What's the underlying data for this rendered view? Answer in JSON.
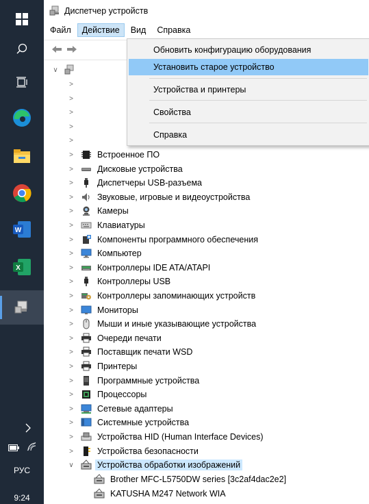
{
  "window": {
    "title": "Диспетчер устройств"
  },
  "menubar": {
    "file": "Файл",
    "action": "Действие",
    "view": "Вид",
    "help": "Справка"
  },
  "action_menu": {
    "items": [
      "Обновить конфигурацию оборудования",
      "Установить старое устройство",
      "Устройства и принтеры",
      "Свойства",
      "Справка"
    ],
    "highlighted": "Установить старое устройство"
  },
  "tree": {
    "categories": [
      {
        "label": "Встроенное ПО",
        "icon": "firmware-icon"
      },
      {
        "label": "Дисковые устройства",
        "icon": "disk-drive-icon"
      },
      {
        "label": "Диспетчеры USB-разъема",
        "icon": "usb-icon"
      },
      {
        "label": "Звуковые, игровые и видеоустройства",
        "icon": "speaker-icon"
      },
      {
        "label": "Камеры",
        "icon": "camera-icon"
      },
      {
        "label": "Клавиатуры",
        "icon": "keyboard-icon"
      },
      {
        "label": "Компоненты программного обеспечения",
        "icon": "software-component-icon"
      },
      {
        "label": "Компьютер",
        "icon": "computer-icon"
      },
      {
        "label": "Контроллеры IDE ATA/ATAPI",
        "icon": "ide-controller-icon"
      },
      {
        "label": "Контроллеры USB",
        "icon": "usb-icon"
      },
      {
        "label": "Контроллеры запоминающих устройств",
        "icon": "storage-controller-icon"
      },
      {
        "label": "Мониторы",
        "icon": "monitor-icon"
      },
      {
        "label": "Мыши и иные указывающие устройства",
        "icon": "mouse-icon"
      },
      {
        "label": "Очереди печати",
        "icon": "printer-icon"
      },
      {
        "label": "Поставщик печати WSD",
        "icon": "printer-icon"
      },
      {
        "label": "Принтеры",
        "icon": "printer-icon"
      },
      {
        "label": "Программные устройства",
        "icon": "software-device-icon"
      },
      {
        "label": "Процессоры",
        "icon": "processor-icon"
      },
      {
        "label": "Сетевые адаптеры",
        "icon": "network-adapter-icon"
      },
      {
        "label": "Системные устройства",
        "icon": "system-devices-icon"
      },
      {
        "label": "Устройства HID (Human Interface Devices)",
        "icon": "hid-icon"
      },
      {
        "label": "Устройства безопасности",
        "icon": "security-device-icon"
      },
      {
        "label": "Устройства обработки изображений",
        "icon": "imaging-device-icon",
        "expanded": true,
        "selected": true
      }
    ],
    "imaging_children": [
      "Brother MFC-L5750DW series [3c2af4dac2e2]",
      "KATUSHA M247 Network WIA"
    ]
  },
  "taskbar": {
    "language": "РУС",
    "time": "9:24",
    "icons": [
      "windows-start-icon",
      "search-icon",
      "task-view-icon",
      "edge-icon",
      "file-explorer-icon",
      "chrome-icon",
      "word-icon",
      "excel-icon",
      "device-manager-icon"
    ]
  }
}
